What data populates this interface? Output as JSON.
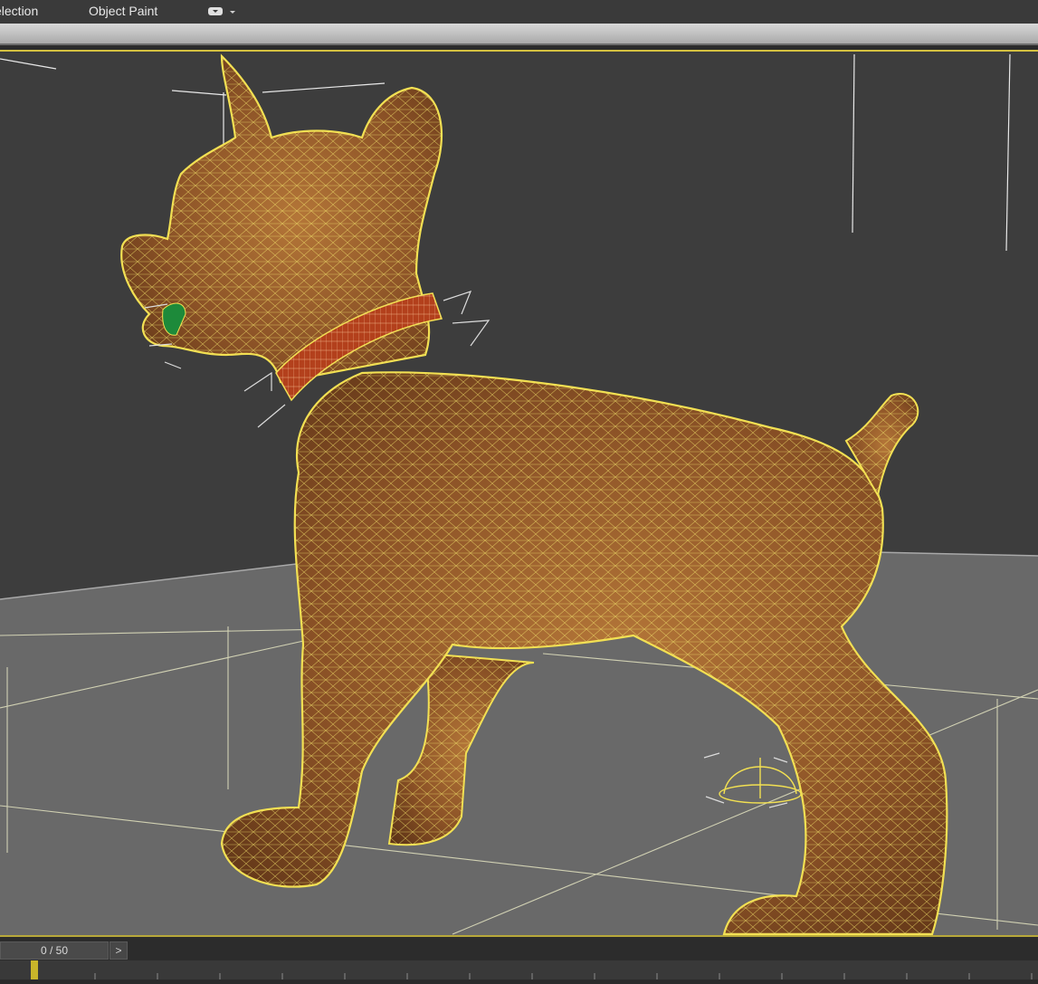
{
  "menubar": {
    "items": [
      {
        "label": "election"
      },
      {
        "label": "Object Paint"
      }
    ],
    "dropdown_icon": "menu-dropdown-icon"
  },
  "viewport": {
    "background": "#3d3d3d",
    "floor_color": "#6b6b6b",
    "wire_color": "#f2e052",
    "model_color": "#9a5f2d",
    "collar_color": "#b3401c"
  },
  "timeline": {
    "frame_label": "0 / 50",
    "next_frame_icon": ">",
    "current_frame": 0,
    "total_frames": 50
  }
}
